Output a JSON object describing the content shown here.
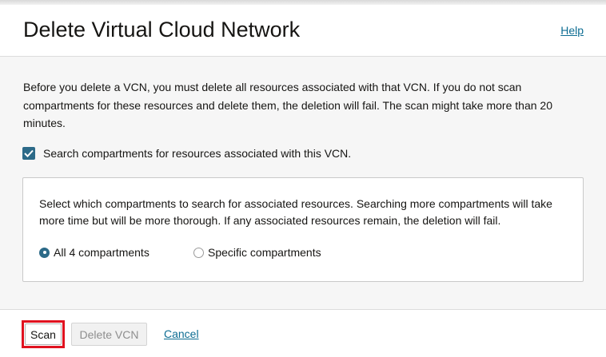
{
  "dialog": {
    "title": "Delete Virtual Cloud Network",
    "help_label": "Help"
  },
  "body": {
    "intro": "Before you delete a VCN, you must delete all resources associated with that VCN. If you do not scan compartments for these resources and delete them, the deletion will fail. The scan might take more than 20 minutes.",
    "search_checkbox": {
      "label": "Search compartments for resources associated with this VCN.",
      "checked": true
    },
    "panel": {
      "description": "Select which compartments to search for associated resources. Searching more compartments will take more time but will be more thorough. If any associated resources remain, the deletion will fail.",
      "options": [
        {
          "label": "All 4 compartments",
          "selected": true
        },
        {
          "label": "Specific compartments",
          "selected": false
        }
      ]
    }
  },
  "footer": {
    "scan_label": "Scan",
    "delete_label": "Delete VCN",
    "cancel_label": "Cancel"
  },
  "colors": {
    "accent": "#2c6a88",
    "link": "#0d6d93",
    "highlight": "#e0121f",
    "body_background": "#f6f6f6"
  },
  "icons": {
    "checkbox": "check-icon"
  }
}
